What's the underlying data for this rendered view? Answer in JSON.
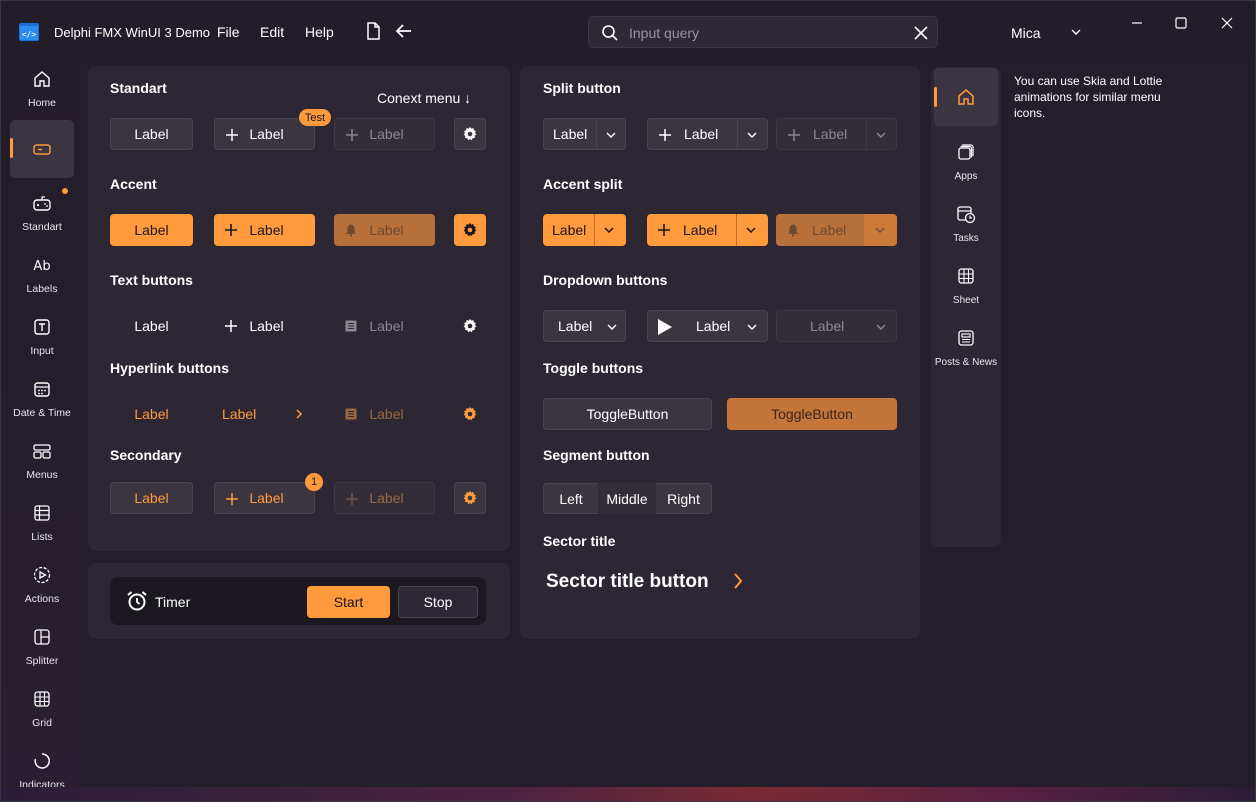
{
  "app": {
    "title": "Delphi FMX WinUI 3 Demo",
    "menu": [
      "File",
      "Edit",
      "Help"
    ],
    "theme": "Mica"
  },
  "search": {
    "placeholder": "Input query"
  },
  "nav": {
    "items": [
      {
        "label": "Home",
        "icon": "home-icon"
      },
      {
        "label": "",
        "icon": "button-icon",
        "active": true
      },
      {
        "label": "Standart",
        "icon": "gamepad-icon"
      },
      {
        "label": "Labels",
        "icon": "text-ab-icon"
      },
      {
        "label": "Input",
        "icon": "textbox-icon"
      },
      {
        "label": "Date & Time",
        "icon": "calendar-icon"
      },
      {
        "label": "Menus",
        "icon": "menu-icon"
      },
      {
        "label": "Lists",
        "icon": "list-icon"
      },
      {
        "label": "Actions",
        "icon": "play-circle-icon"
      },
      {
        "label": "Splitter",
        "icon": "splitter-icon"
      },
      {
        "label": "Grid",
        "icon": "grid-icon"
      },
      {
        "label": "Indicators",
        "icon": "spinner-icon"
      }
    ]
  },
  "left_panel": {
    "standart": {
      "title": "Standart",
      "context_menu": "Conext menu ↓",
      "badge": "Test",
      "label": "Label"
    },
    "accent": {
      "title": "Accent",
      "label": "Label"
    },
    "text_buttons": {
      "title": "Text buttons",
      "label": "Label"
    },
    "hyperlink": {
      "title": "Hyperlink buttons",
      "label": "Label"
    },
    "secondary": {
      "title": "Secondary",
      "label": "Label",
      "badge": "1"
    }
  },
  "timer": {
    "label": "Timer",
    "start": "Start",
    "stop": "Stop"
  },
  "right_panel": {
    "split": {
      "title": "Split button",
      "label": "Label"
    },
    "accent_split": {
      "title": "Accent split",
      "label": "Label"
    },
    "dropdown": {
      "title": "Dropdown buttons",
      "label": "Label"
    },
    "toggle": {
      "title": "Toggle buttons",
      "label": "ToggleButton"
    },
    "segment": {
      "title": "Segment button",
      "items": [
        "Left",
        "Middle",
        "Right"
      ]
    },
    "sector": {
      "title": "Sector title",
      "button": "Sector title button"
    }
  },
  "rnav": {
    "items": [
      {
        "label": "",
        "icon": "home-icon",
        "active": true
      },
      {
        "label": "Apps",
        "icon": "apps-icon"
      },
      {
        "label": "Tasks",
        "icon": "tasks-icon"
      },
      {
        "label": "Sheet",
        "icon": "sheet-icon"
      },
      {
        "label": "Posts & News",
        "icon": "news-icon"
      }
    ],
    "info": "You can use Skia and Lottie animations for similar menu icons."
  },
  "colors": {
    "accent": "#ff9a3d",
    "panel": "#2d2733",
    "background": "#241d2a"
  }
}
